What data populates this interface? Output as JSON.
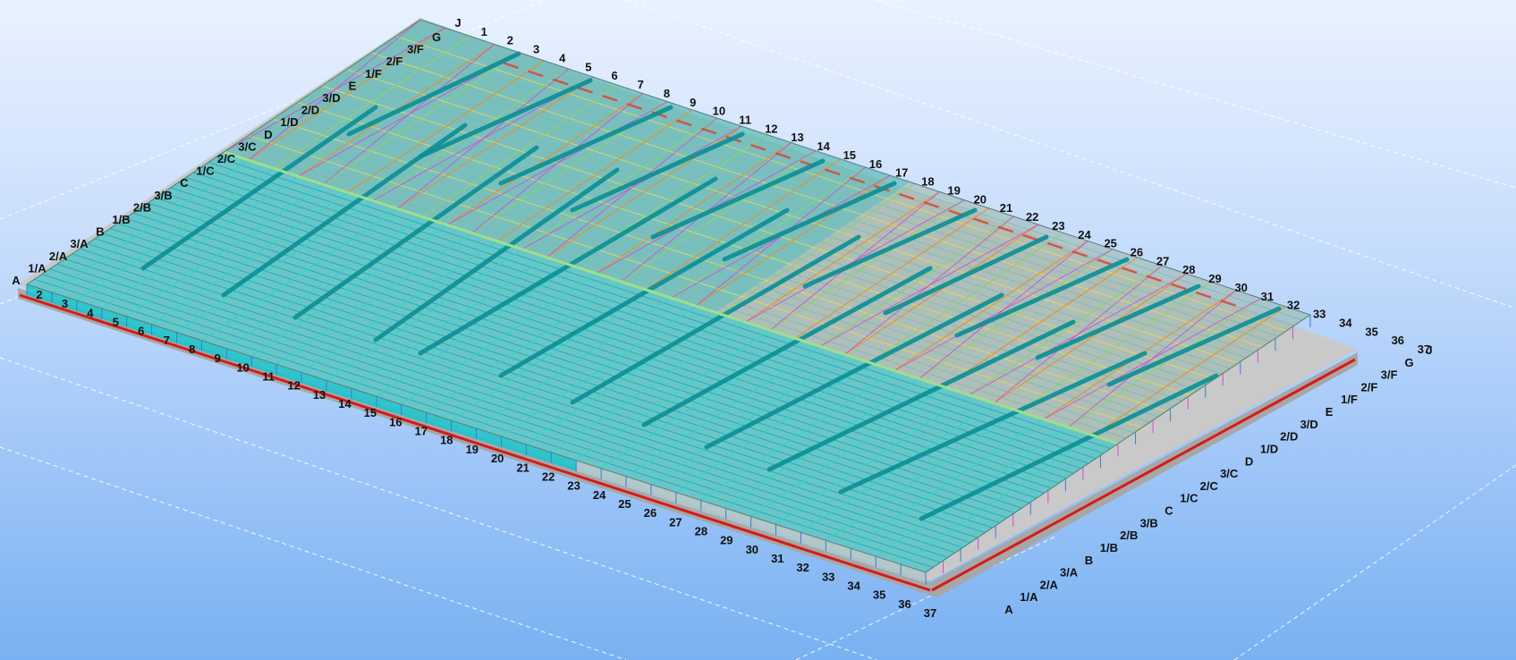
{
  "viewport": {
    "colors": {
      "background_top": "#e9f2ff",
      "background_bottom": "#79b1f2",
      "roof_primary": "#18c3c9",
      "roof_dark": "#0a8f95",
      "purlin": "#1aa6ad",
      "bracing": "#d24bd0",
      "rafter": "#e8902a",
      "accent_yellow": "#e6e04a",
      "slab": "#c9c9c9",
      "slab_edge": "#d61a1a",
      "grid_line": "#ffffff"
    }
  },
  "gridlines": {
    "numbers_front": [
      "2",
      "3",
      "4",
      "5",
      "6",
      "7",
      "8",
      "9",
      "10",
      "11",
      "12",
      "13",
      "14",
      "15",
      "16",
      "17",
      "18",
      "19",
      "20",
      "21",
      "22",
      "23",
      "24",
      "25",
      "26",
      "27",
      "28",
      "29",
      "30",
      "31",
      "32",
      "33",
      "34",
      "35",
      "36",
      "37"
    ],
    "numbers_back": [
      "J",
      "1",
      "2",
      "3",
      "4",
      "5",
      "6",
      "7",
      "8",
      "9",
      "10",
      "11",
      "12",
      "13",
      "14",
      "15",
      "16",
      "17",
      "18",
      "19",
      "20",
      "21",
      "22",
      "23",
      "24",
      "25",
      "26",
      "27",
      "28",
      "29",
      "30",
      "31",
      "32",
      "33",
      "34",
      "35",
      "36",
      "37"
    ],
    "letters_left": [
      "A",
      "1/A",
      "2/A",
      "3/A",
      "B",
      "1/B",
      "2/B",
      "3/B",
      "C",
      "1/C",
      "2/C",
      "3/C",
      "D",
      "1/D",
      "2/D",
      "3/D",
      "E",
      "1/F",
      "2/F",
      "3/F",
      "G"
    ],
    "letters_right": [
      "A",
      "1/A",
      "2/A",
      "3/A",
      "B",
      "1/B",
      "2/B",
      "3/B",
      "C",
      "1/C",
      "2/C",
      "3/C",
      "D",
      "1/D",
      "2/D",
      "3/D",
      "E",
      "1/F",
      "2/F",
      "3/F",
      "G",
      "J"
    ]
  }
}
